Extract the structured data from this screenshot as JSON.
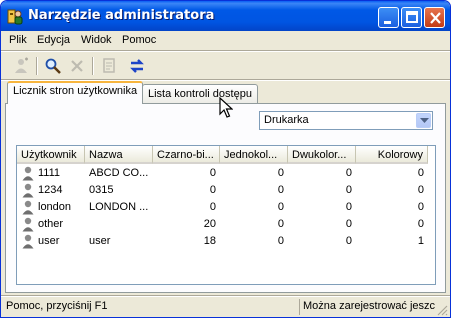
{
  "window": {
    "title": "Narzędzie administratora"
  },
  "menu": [
    "Plik",
    "Edycja",
    "Widok",
    "Pomoc"
  ],
  "toolbar": {
    "icons": [
      "add-user-icon",
      "search-icon",
      "delete-icon",
      "properties-icon",
      "refresh-icon"
    ]
  },
  "tabs": [
    {
      "label": "Licznik stron użytkownika",
      "active": true
    },
    {
      "label": "Lista kontroli dostępu",
      "active": false
    }
  ],
  "printer_select": {
    "value": "Drukarka"
  },
  "table": {
    "columns": [
      "Użytkownik",
      "Nazwa",
      "Czarno-bi...",
      "Jednokol...",
      "Dwukolor...",
      "Kolorowy"
    ],
    "rows": [
      {
        "user": "1111",
        "name": "ABCD CO...",
        "bw": "0",
        "mono": "0",
        "duo": "0",
        "color": "0"
      },
      {
        "user": "1234",
        "name": "0315",
        "bw": "0",
        "mono": "0",
        "duo": "0",
        "color": "0"
      },
      {
        "user": "london",
        "name": "LONDON ...",
        "bw": "0",
        "mono": "0",
        "duo": "0",
        "color": "0"
      },
      {
        "user": "other",
        "name": "",
        "bw": "20",
        "mono": "0",
        "duo": "0",
        "color": "0"
      },
      {
        "user": "user",
        "name": "user",
        "bw": "18",
        "mono": "0",
        "duo": "0",
        "color": "1"
      }
    ]
  },
  "status": {
    "left": "Pomoc, przyciśnij F1",
    "right": "Można zarejestrować jeszc"
  },
  "colors": {
    "titlebar": "#0058e6",
    "window_bg": "#ece9d8",
    "active_tab_accent": "#f7b53f"
  }
}
